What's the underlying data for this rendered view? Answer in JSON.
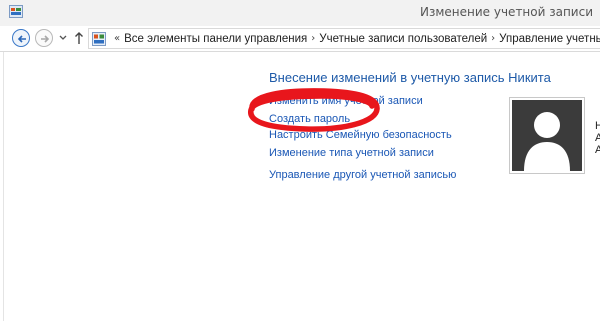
{
  "window": {
    "title": "Изменение учетной записи"
  },
  "navigation": {
    "breadcrumb_prefix": "«",
    "breadcrumbs": [
      "Все элементы панели управления",
      "Учетные записи пользователей",
      "Управление учетными записями"
    ],
    "separator": "›"
  },
  "main": {
    "heading": "Внесение изменений в учетную запись Никита",
    "links": {
      "obscured": "Изменить имя учетной записи",
      "create_password": "Создать пароль",
      "family_safety": "Настроить Семейную безопасность",
      "change_type": "Изменение типа учетной записи",
      "manage_other": "Управление другой учетной записью"
    }
  },
  "account_card": {
    "name_fragment": "Н",
    "type_fragment": "А",
    "status_fragment": "А"
  },
  "annotation": {
    "color": "#e8161c",
    "target": "create_password"
  },
  "icons": [
    "control-panel-icon",
    "back-arrow-icon",
    "forward-arrow-icon",
    "dropdown-icon",
    "up-arrow-icon",
    "user-avatar-icon"
  ]
}
